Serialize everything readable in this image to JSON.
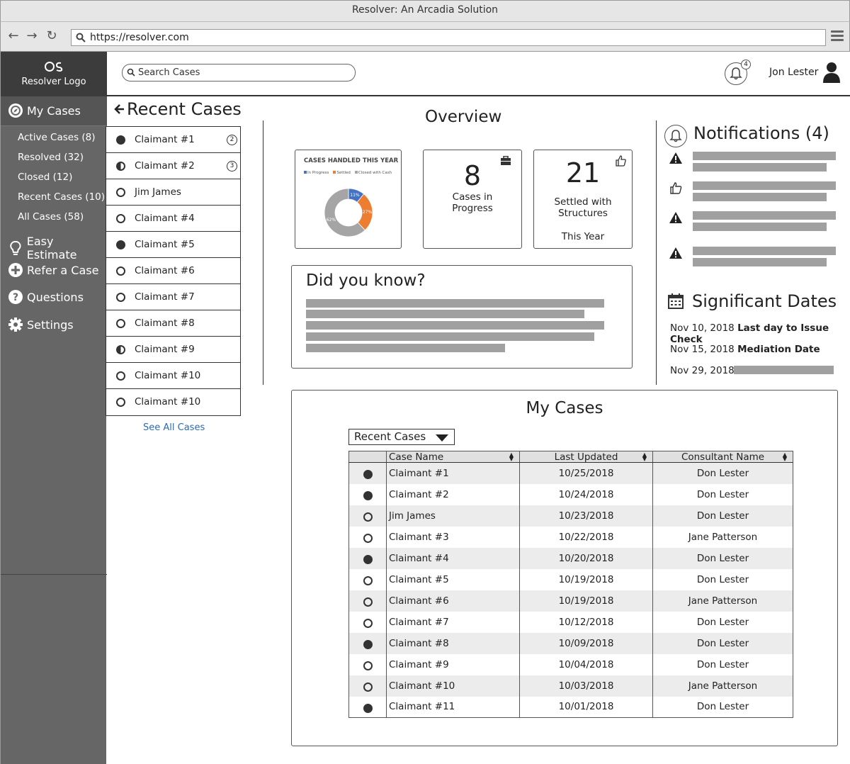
{
  "window": {
    "title": "Resolver: An Arcadia Solution",
    "url": "https://resolver.com"
  },
  "sidebar": {
    "logo_text": "Resolver Logo",
    "my_cases": "My Cases",
    "sub_items": [
      "Active Cases (8)",
      "Resolved (32)",
      "Closed (12)",
      "Recent Cases (10)",
      "All Cases (58)"
    ],
    "easy_estimate": "Easy Estimate",
    "refer_case": "Refer a Case",
    "questions": "Questions",
    "settings": "Settings"
  },
  "header": {
    "search_placeholder": "Search Cases",
    "notification_count": "4",
    "user_name": "Jon Lester"
  },
  "recent_cases": {
    "title": "Recent Cases",
    "items": [
      {
        "name": "Claimant #1",
        "status": "filled",
        "badge": "2"
      },
      {
        "name": "Claimant #2",
        "status": "half",
        "badge": "3"
      },
      {
        "name": "Jim James",
        "status": "empty",
        "badge": ""
      },
      {
        "name": "Claimant #4",
        "status": "empty",
        "badge": ""
      },
      {
        "name": "Claimant #5",
        "status": "filled",
        "badge": ""
      },
      {
        "name": "Claimant #6",
        "status": "empty",
        "badge": ""
      },
      {
        "name": "Claimant #7",
        "status": "empty",
        "badge": ""
      },
      {
        "name": "Claimant #8",
        "status": "empty",
        "badge": ""
      },
      {
        "name": "Claimant #9",
        "status": "half",
        "badge": ""
      },
      {
        "name": "Claimant #10",
        "status": "empty",
        "badge": ""
      },
      {
        "name": "Claimant #10",
        "status": "empty",
        "badge": ""
      }
    ],
    "see_all": "See All Cases"
  },
  "overview": {
    "title": "Overview",
    "stat1": {
      "value": "8",
      "label_line1": "Cases in",
      "label_line2": "Progress"
    },
    "stat2": {
      "value": "21",
      "label_line1": "Settled with",
      "label_line2": "Structures",
      "label_line3": "This Year"
    },
    "did_you_know": "Did you know?"
  },
  "chart_data": {
    "type": "pie",
    "title": "CASES HANDLED THIS YEAR",
    "categories": [
      "In Progress",
      "Settled",
      "Closed with Cash"
    ],
    "values": [
      11,
      27,
      62
    ],
    "labels": [
      "11%",
      "27%",
      "62%"
    ],
    "colors": [
      "#4472c4",
      "#ed7d31",
      "#a5a5a5"
    ]
  },
  "notifications": {
    "title": "Notifications (4)",
    "icons": [
      "warning-icon",
      "thumbs-up-icon",
      "warning-icon",
      "warning-icon"
    ]
  },
  "significant_dates": {
    "title": "Significant Dates",
    "rows": [
      {
        "date": "Nov 10, 2018",
        "event": "Last day to Issue Check"
      },
      {
        "date": "Nov 15, 2018",
        "event": "Mediation Date"
      },
      {
        "date": "Nov 29, 2018",
        "event": ""
      }
    ]
  },
  "my_cases": {
    "title": "My Cases",
    "filter": "Recent Cases",
    "columns": [
      "Case Name",
      "Last Updated",
      "Consultant Name"
    ],
    "rows": [
      {
        "status": "filled",
        "name": "Claimant #1",
        "updated": "10/25/2018",
        "consultant": "Don Lester"
      },
      {
        "status": "filled",
        "name": "Claimant #2",
        "updated": "10/24/2018",
        "consultant": "Don Lester"
      },
      {
        "status": "empty",
        "name": "Jim James",
        "updated": "10/23/2018",
        "consultant": "Don Lester"
      },
      {
        "status": "empty",
        "name": "Claimant #3",
        "updated": "10/22/2018",
        "consultant": "Jane Patterson"
      },
      {
        "status": "filled",
        "name": "Claimant #4",
        "updated": "10/20/2018",
        "consultant": "Don Lester"
      },
      {
        "status": "empty",
        "name": "Claimant #5",
        "updated": "10/19/2018",
        "consultant": "Don Lester"
      },
      {
        "status": "empty",
        "name": "Claimant #6",
        "updated": "10/19/2018",
        "consultant": "Jane Patterson"
      },
      {
        "status": "empty",
        "name": "Claimant #7",
        "updated": "10/12/2018",
        "consultant": "Don Lester"
      },
      {
        "status": "filled",
        "name": "Claimant #8",
        "updated": "10/09/2018",
        "consultant": "Don Lester"
      },
      {
        "status": "empty",
        "name": "Claimant #9",
        "updated": "10/04/2018",
        "consultant": "Don Lester"
      },
      {
        "status": "empty",
        "name": "Claimant #10",
        "updated": "10/03/2018",
        "consultant": "Jane Patterson"
      },
      {
        "status": "filled",
        "name": "Claimant #11",
        "updated": "10/01/2018",
        "consultant": "Don Lester"
      }
    ]
  }
}
